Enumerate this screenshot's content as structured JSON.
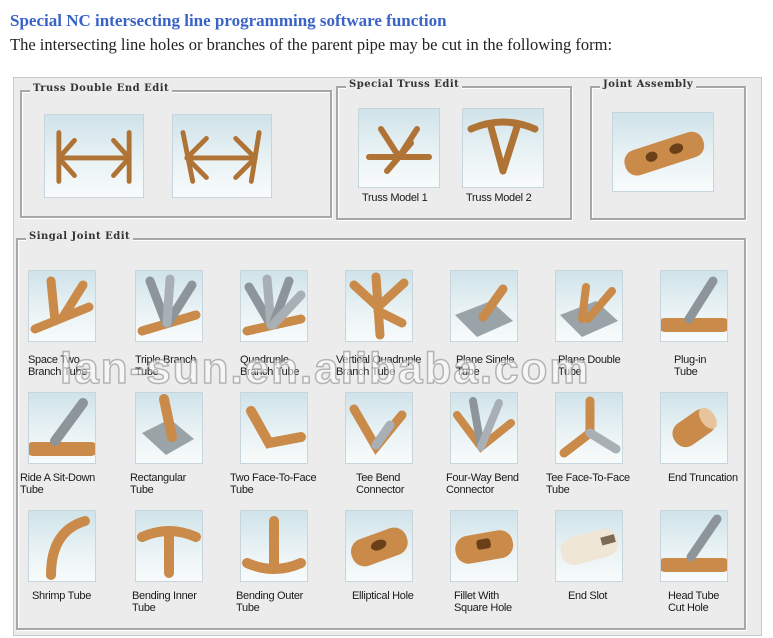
{
  "header": {
    "title": "Special NC intersecting line programming software function",
    "subtitle": "The intersecting line holes or branches of the parent pipe may be cut in the following form:"
  },
  "groups": {
    "truss_double": {
      "title": "Truss Double End Edit"
    },
    "special_truss": {
      "title": "Special Truss Edit",
      "items": [
        {
          "line1": "Truss Model 1",
          "line2": ""
        },
        {
          "line1": "Truss Model 2",
          "line2": ""
        }
      ]
    },
    "joint_assembly": {
      "title": "Joint Assembly"
    },
    "single_joint": {
      "title": "Singal Joint Edit",
      "rows": [
        [
          {
            "line1": "Space Two",
            "line2": "Branch Tube"
          },
          {
            "line1": "Triple Branch",
            "line2": "Tube"
          },
          {
            "line1": "Quadruple",
            "line2": "Branch Tube"
          },
          {
            "line1": "Vertical Quadruple",
            "line2": "Branch Tube"
          },
          {
            "line1": "Plane Single",
            "line2": "Tube"
          },
          {
            "line1": "Plane Double",
            "line2": "Tube"
          },
          {
            "line1": "Plug-in",
            "line2": "Tube"
          }
        ],
        [
          {
            "line1": "Ride A Sit-Down",
            "line2": "Tube"
          },
          {
            "line1": "Rectangular",
            "line2": "Tube"
          },
          {
            "line1": "Two Face-To-Face",
            "line2": "Tube"
          },
          {
            "line1": "Tee Bend",
            "line2": "Connector"
          },
          {
            "line1": "Four-Way Bend",
            "line2": "Connector"
          },
          {
            "line1": "Tee Face-To-Face",
            "line2": "Tube"
          },
          {
            "line1": "End Truncation",
            "line2": ""
          }
        ],
        [
          {
            "line1": "Shrimp Tube",
            "line2": ""
          },
          {
            "line1": "Bending Inner",
            "line2": "Tube"
          },
          {
            "line1": "Bending Outer",
            "line2": "Tube"
          },
          {
            "line1": "Elliptical Hole",
            "line2": ""
          },
          {
            "line1": "Fillet With",
            "line2": "Square Hole"
          },
          {
            "line1": "End Slot",
            "line2": ""
          },
          {
            "line1": "Head Tube",
            "line2": "Cut Hole"
          }
        ]
      ]
    }
  },
  "watermark": "lan-sun.en.alibaba.com",
  "colors": {
    "title": "#3a63c8",
    "tube": "#c98a4a",
    "steel": "#8d959b",
    "plate": "#9aa3a8"
  }
}
